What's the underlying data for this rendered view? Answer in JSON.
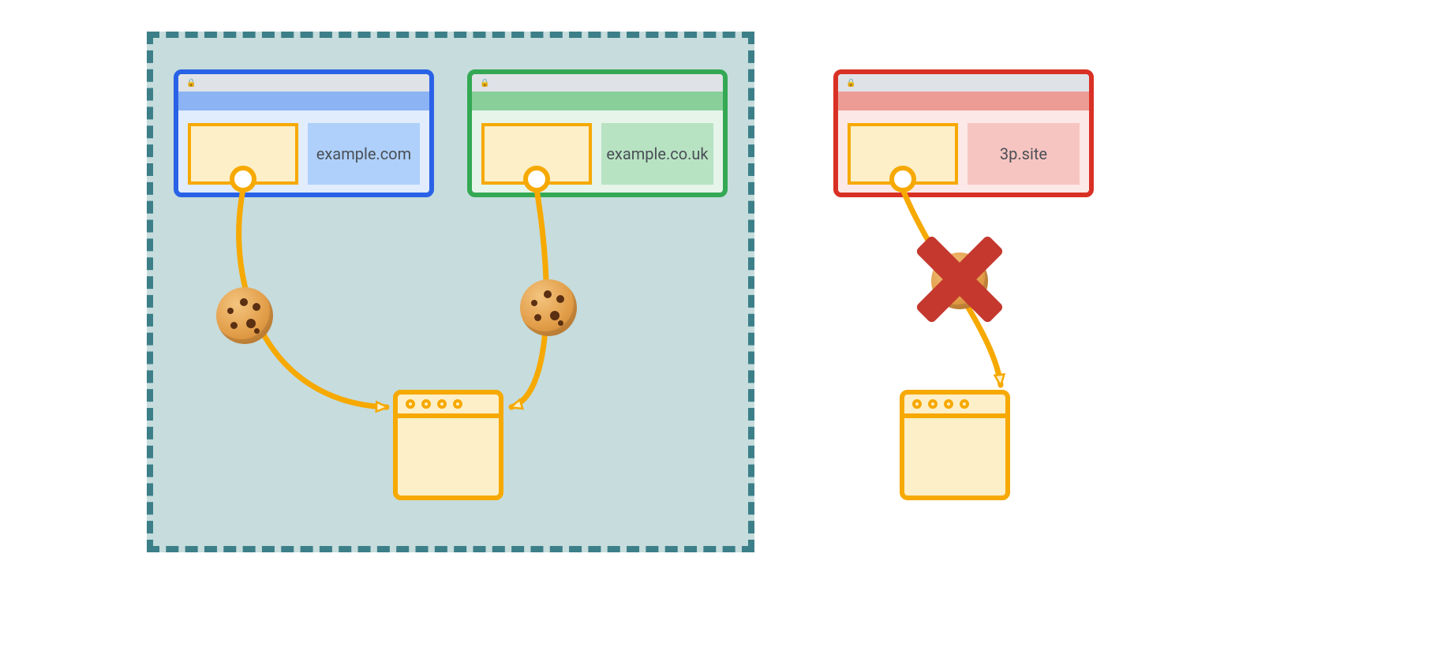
{
  "diagram": {
    "description": "Related websites can share cookies with their origin; an unrelated third-party site's cookie is blocked.",
    "relatedSitesGroup": {
      "sites": [
        {
          "domain": "example.com",
          "theme": "blue"
        },
        {
          "domain": "example.co.uk",
          "theme": "green"
        }
      ],
      "cookieSent": true,
      "target": "shared first-party server"
    },
    "thirdParty": {
      "domain": "3p.site",
      "theme": "red",
      "cookieSent": false,
      "blocked": true,
      "target": "first-party server"
    },
    "icons": {
      "lock": "🔒",
      "cookie": "cookie-icon",
      "block": "x-mark"
    },
    "colors": {
      "groupBorder": "#3c7f88",
      "groupFill": "#c6dcdd",
      "accent": "#f6a900",
      "blue": "#2962e6",
      "green": "#34a853",
      "red": "#d93025",
      "blockX": "#c5382e"
    }
  }
}
